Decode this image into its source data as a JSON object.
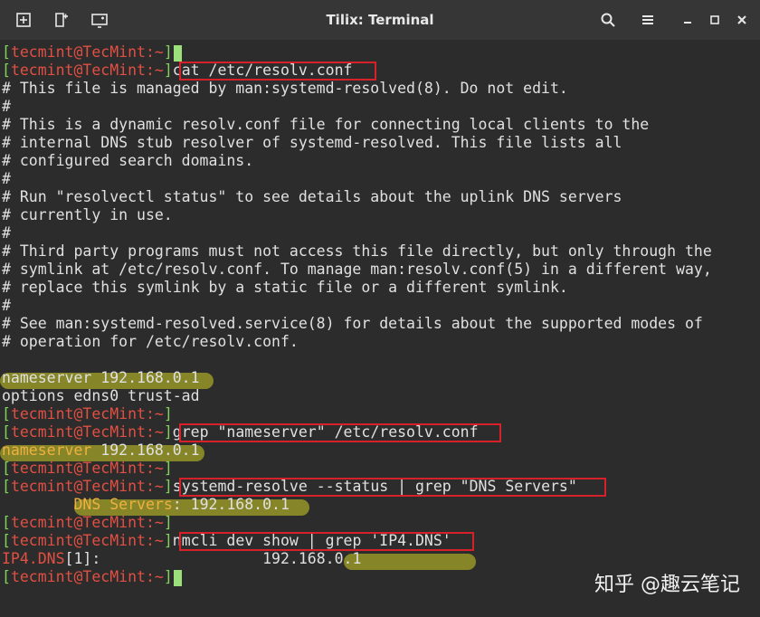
{
  "window": {
    "title": "Tilix: Terminal",
    "icons": [
      "add-terminal-right-icon",
      "add-terminal-down-icon",
      "sessions-icon",
      "search-icon",
      "menu-icon",
      "minimize-icon",
      "maximize-icon",
      "close-icon"
    ]
  },
  "prompt": {
    "open": "[",
    "user": "tecmint",
    "at": "@",
    "host": "TecMint",
    "path": ":~",
    "close": "]"
  },
  "commands": {
    "cat": "cat /etc/resolv.conf",
    "grep": "grep \"nameserver\" /etc/resolv.conf",
    "resolve": "systemd-resolve --status | grep \"DNS Servers\"",
    "nmcli": "nmcli dev show | grep 'IP4.DNS'"
  },
  "resolv_conf_lines": [
    "# This file is managed by man:systemd-resolved(8). Do not edit.",
    "#",
    "# This is a dynamic resolv.conf file for connecting local clients to the",
    "# internal DNS stub resolver of systemd-resolved. This file lists all",
    "# configured search domains.",
    "#",
    "# Run \"resolvectl status\" to see details about the uplink DNS servers",
    "# currently in use.",
    "#",
    "# Third party programs must not access this file directly, but only through the",
    "# symlink at /etc/resolv.conf. To manage man:resolv.conf(5) in a different way,",
    "# replace this symlink by a static file or a different symlink.",
    "#",
    "# See man:systemd-resolved.service(8) for details about the supported modes of",
    "# operation for /etc/resolv.conf."
  ],
  "output": {
    "nameserver_line": "nameserver 192.168.0.1",
    "options_line": "options edns0 trust-ad",
    "grep_keyword": "nameserver",
    "grep_rest": " 192.168.0.1",
    "dns_indent": "        ",
    "dns_key": "DNS Servers",
    "dns_rest": ": 192.168.0.1",
    "ip4_key": "IP4.DNS",
    "ip4_suffix": "[1]:",
    "ip4_pad": "                  ",
    "ip4_value": "192.168.0.1"
  },
  "watermark": "知乎 @趣云笔记"
}
